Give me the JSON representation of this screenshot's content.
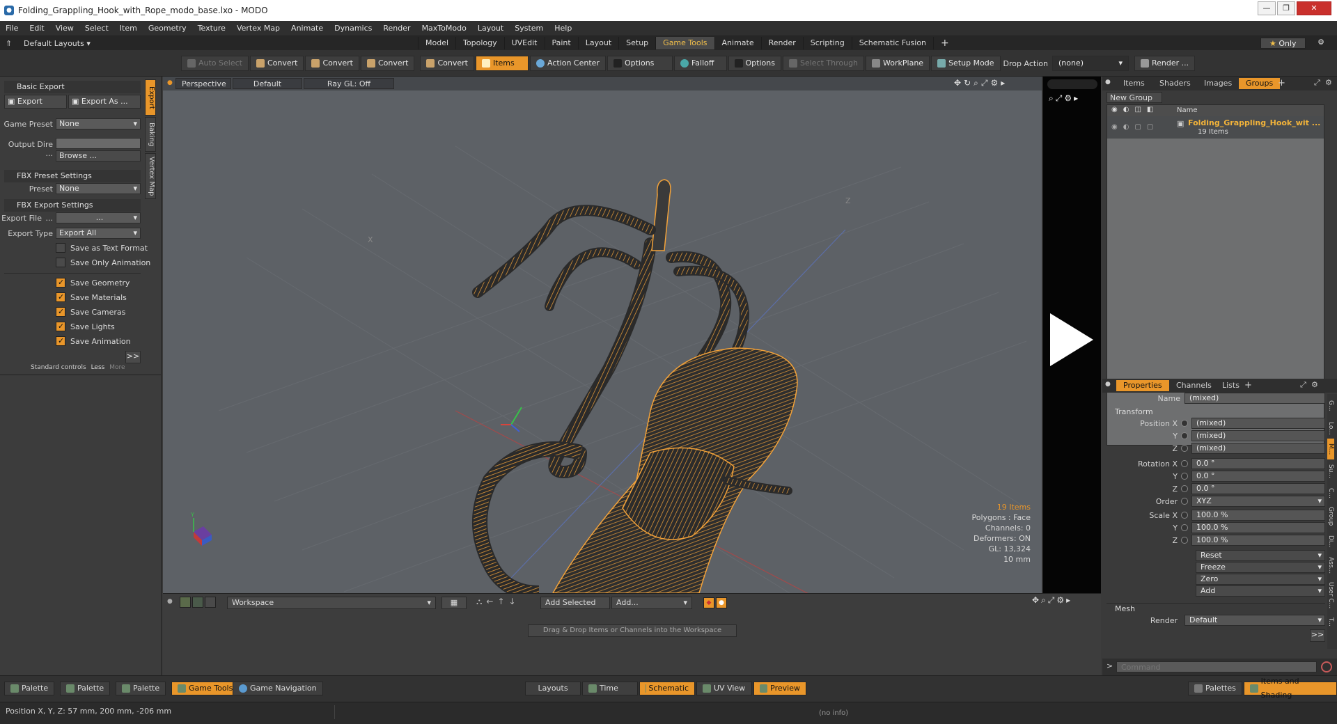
{
  "window": {
    "title": "Folding_Grappling_Hook_with_Rope_modo_base.lxo - MODO",
    "app_icon": "modo-logo-icon"
  },
  "menu": [
    "File",
    "Edit",
    "View",
    "Select",
    "Item",
    "Geometry",
    "Texture",
    "Vertex Map",
    "Animate",
    "Dynamics",
    "Render",
    "MaxToModo",
    "Layout",
    "System",
    "Help"
  ],
  "layout_row": {
    "layouts_label": "Default Layouts",
    "tabs": [
      "Model",
      "Topology",
      "UVEdit",
      "Paint",
      "Layout",
      "Setup",
      "Game Tools",
      "Animate",
      "Render",
      "Scripting",
      "Schematic Fusion"
    ],
    "active_tab": "Game Tools",
    "only_label": "Only"
  },
  "toolbar": {
    "auto_select": "Auto Select",
    "convert1": "Convert",
    "convert2": "Convert",
    "convert3": "Convert",
    "convert4": "Convert",
    "items": "Items",
    "action_center": "Action Center",
    "options1": "Options",
    "falloff": "Falloff",
    "options2": "Options",
    "select_through": "Select Through",
    "workplane": "WorkPlane",
    "setup_mode": "Setup Mode",
    "drop_action": "Drop Action",
    "drop_value": "(none)",
    "render": "Render ..."
  },
  "left_panel": {
    "basic_export": "Basic Export",
    "export_btn": "Export",
    "export_as_btn": "Export As ...",
    "game_preset_label": "Game Preset",
    "game_preset_value": "None",
    "output_dir_label": "Output Dire ...",
    "browse_btn": "Browse ...",
    "fbx_preset_settings": "FBX Preset Settings",
    "preset_label": "Preset",
    "preset_value": "None",
    "fbx_export_settings": "FBX Export Settings",
    "export_file_label": "Export File",
    "export_file_dots": "...",
    "export_file_value": "...",
    "export_type_label": "Export Type",
    "export_type_value": "Export All",
    "save_text_format": "Save as Text Format",
    "save_only_animation": "Save Only Animation",
    "save_geometry": "Save Geometry",
    "save_materials": "Save Materials",
    "save_cameras": "Save Cameras",
    "save_lights": "Save Lights",
    "save_animation": "Save Animation",
    "more_btn": ">>",
    "standard_controls": "Standard controls",
    "less": "Less",
    "more": "More",
    "vtabs": [
      "Export",
      "Baking",
      "Vertex Map"
    ]
  },
  "viewport": {
    "view": "Perspective",
    "shading": "Default",
    "raygl": "Ray GL: Off",
    "axis_label_z": "Z",
    "axis_label_x": "X",
    "info": {
      "items": "19 Items",
      "polygons": "Polygons : Face",
      "channels": "Channels: 0",
      "deformers": "Deformers: ON",
      "gl": "GL: 13,324",
      "scale": "10 mm"
    }
  },
  "right_panel": {
    "top_tabs": [
      "Items",
      "Shaders",
      "Images",
      "Groups"
    ],
    "active_top_tab": "Groups",
    "new_group": "New Group",
    "name_col": "Name",
    "group_name": "Folding_Grappling_Hook_wit ...",
    "group_count": "19 Items",
    "prop_tabs": [
      "Properties",
      "Channels",
      "Lists"
    ],
    "name_label": "Name",
    "name_value": "(mixed)",
    "transform": "Transform",
    "position_x_label": "Position X",
    "y_label": "Y",
    "z_label": "Z",
    "pos": [
      "(mixed)",
      "(mixed)",
      "(mixed)"
    ],
    "rotation_x_label": "Rotation X",
    "rot": [
      "0.0 °",
      "0.0 °",
      "0.0 °"
    ],
    "order_label": "Order",
    "order_value": "XYZ",
    "scale_x_label": "Scale X",
    "scale": [
      "100.0 %",
      "100.0 %",
      "100.0 %"
    ],
    "reset": "Reset",
    "freeze": "Freeze",
    "zero": "Zero",
    "add": "Add",
    "mesh": "Mesh",
    "render_label": "Render",
    "render_value": "Default",
    "more_btn": ">>",
    "command_placeholder": "Command",
    "side_tabs": [
      "G...",
      "Lo...",
      "M...",
      "Su...",
      "C...",
      "Group",
      "Di...",
      "Ass...",
      "User C...",
      "T..."
    ]
  },
  "workspace": {
    "workspace_value": "Workspace",
    "add_selected": "Add Selected",
    "add": "Add...",
    "hint": "Drag & Drop Items or Channels into the Workspace"
  },
  "palette_bar": {
    "palette1": "Palette",
    "palette2": "Palette",
    "palette3": "Palette",
    "game_tools": "Game Tools",
    "game_navigation": "Game Navigation",
    "layouts": "Layouts",
    "time": "Time",
    "schematic": "Schematic",
    "uv_view": "UV View",
    "preview": "Preview",
    "palettes": "Palettes",
    "items_and_shading": "Items and Shading"
  },
  "status": {
    "position": "Position X, Y, Z:  57 mm, 200 mm, -206 mm",
    "info": "(no info)"
  },
  "colors": {
    "accent": "#e9962a",
    "wire": "#f2a23a",
    "viewport_bg": "#5d6166"
  }
}
